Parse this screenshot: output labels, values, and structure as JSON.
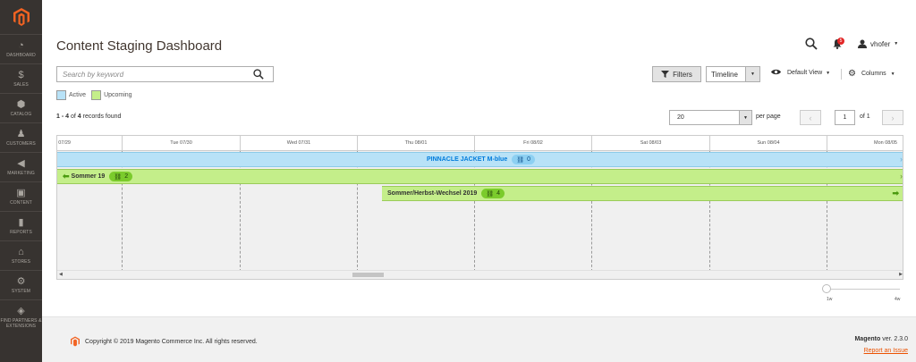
{
  "sidebar": {
    "logo_icon": "magento-logo-icon",
    "items": [
      {
        "label": "DASHBOARD",
        "icon": "speedometer-icon"
      },
      {
        "label": "SALES",
        "icon": "dollar-icon"
      },
      {
        "label": "CATALOG",
        "icon": "cube-icon"
      },
      {
        "label": "CUSTOMERS",
        "icon": "person-icon"
      },
      {
        "label": "MARKETING",
        "icon": "megaphone-icon"
      },
      {
        "label": "CONTENT",
        "icon": "layout-icon"
      },
      {
        "label": "REPORTS",
        "icon": "bar-chart-icon"
      },
      {
        "label": "STORES",
        "icon": "store-icon"
      },
      {
        "label": "SYSTEM",
        "icon": "gear-icon"
      },
      {
        "label": "FIND PARTNERS & EXTENSIONS",
        "icon": "boxes-icon"
      }
    ]
  },
  "header": {
    "title": "Content Staging Dashboard",
    "notification_count": "5",
    "username": "vhofer"
  },
  "search": {
    "placeholder": "Search by keyword"
  },
  "toolbar": {
    "filters_label": "Filters",
    "view_mode": "Timeline",
    "default_view_label": "Default View",
    "columns_label": "Columns"
  },
  "legend": {
    "active": "Active",
    "upcoming": "Upcoming",
    "active_color": "#b8e2f7",
    "upcoming_color": "#c4ee8a"
  },
  "records": {
    "range": "1 - 4",
    "of": "of",
    "total": "4",
    "suffix": "records found"
  },
  "pagination": {
    "per_page_value": "20",
    "per_page_label": "per page",
    "current_page": "1",
    "of_pages": "of 1"
  },
  "timeline": {
    "days": [
      "Mon 07/29",
      "Tue 07/30",
      "Wed 07/31",
      "Thu 08/01",
      "Fri 08/02",
      "Sat 08/03",
      "Sun 08/04",
      "Mon 08/05"
    ],
    "updates": [
      {
        "name": "PINNACLE JACKET M-blue",
        "count": "0",
        "status": "Active"
      },
      {
        "name": "Sommer 19",
        "count": "2",
        "status": "Upcoming"
      },
      {
        "name": "Sommer/Herbst-Wechsel 2019",
        "count": "4",
        "status": "Upcoming"
      }
    ]
  },
  "zoom": {
    "min_label": "1w",
    "max_label": "4w"
  },
  "footer": {
    "copyright": "Copyright © 2019 Magento Commerce Inc. All rights reserved.",
    "brand": "Magento",
    "version": "ver. 2.3.0",
    "report_issue": "Report an Issue"
  }
}
